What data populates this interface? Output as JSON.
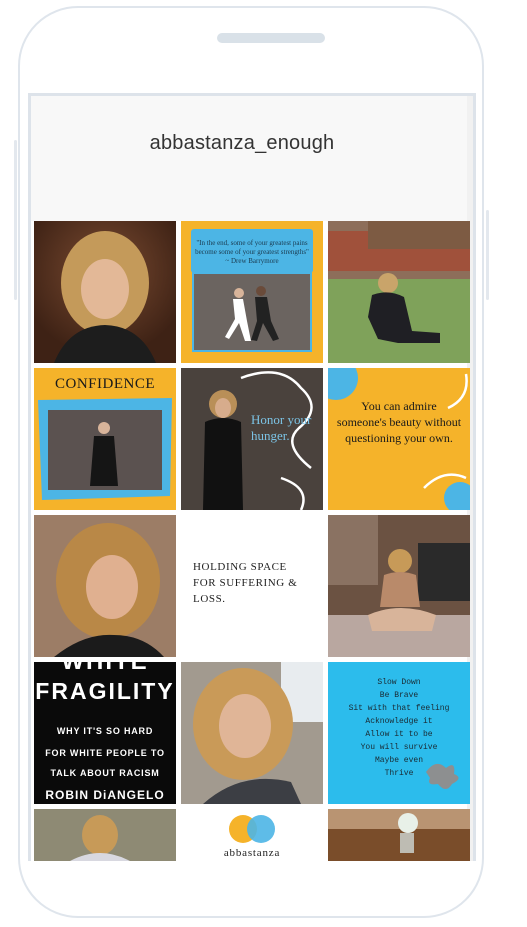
{
  "profile": {
    "username": "abbastanza_enough"
  },
  "posts": {
    "p2_quote": "\"In the end, some of your greatest pains become some of your greatest strengths\" ~ Drew Barrymore",
    "p4_title": "CONFIDENCE",
    "p5_text": "Honor your hunger.",
    "p6_text": "You can admire someone's beauty without questioning your own.",
    "p8_text": "HOLDING SPACE FOR SUFFERING & LOSS.",
    "p10_title": "FRAGILITY",
    "p10_sub1": "WHY IT'S SO HARD",
    "p10_sub2": "FOR WHITE PEOPLE TO",
    "p10_sub3": "TALK ABOUT RACISM",
    "p10_author": "ROBIN DiANGELO",
    "p12_lines": [
      "Slow Down",
      "Be Brave",
      "Sit with that feeling",
      "Acknowledge it",
      "Allow it to be",
      "You will survive",
      "Maybe even",
      "Thrive"
    ],
    "p14_logo_text": "abbastanza"
  }
}
